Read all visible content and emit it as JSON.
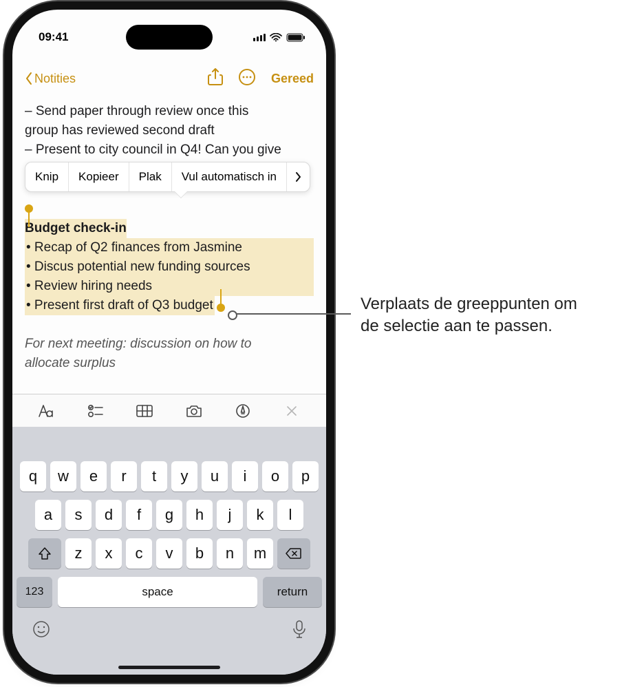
{
  "status": {
    "time": "09:41"
  },
  "nav": {
    "back_label": "Notities",
    "done_label": "Gereed"
  },
  "note": {
    "line1": "– Send paper through review once this",
    "line2": "group has reviewed second draft",
    "line3": "– Present to city council in Q4! Can you give",
    "sel_title": "Budget check-in",
    "sel1": "• Recap of Q2 finances from Jasmine",
    "sel2": "• Discus potential new funding sources",
    "sel3": "• Review hiring needs",
    "sel4": "• Present first draft of Q3 budget",
    "italic1": "For next meeting: discussion on how to",
    "italic2": "allocate surplus"
  },
  "ctx": {
    "cut": "Knip",
    "copy": "Kopieer",
    "paste": "Plak",
    "autofill": "Vul automatisch in"
  },
  "keyboard": {
    "row1": [
      "q",
      "w",
      "e",
      "r",
      "t",
      "y",
      "u",
      "i",
      "o",
      "p"
    ],
    "row2": [
      "a",
      "s",
      "d",
      "f",
      "g",
      "h",
      "j",
      "k",
      "l"
    ],
    "row3": [
      "z",
      "x",
      "c",
      "v",
      "b",
      "n",
      "m"
    ],
    "num": "123",
    "space": "space",
    "ret": "return"
  },
  "callout": {
    "line1": "Verplaats de greeppunten om",
    "line2": "de selectie aan te passen."
  }
}
